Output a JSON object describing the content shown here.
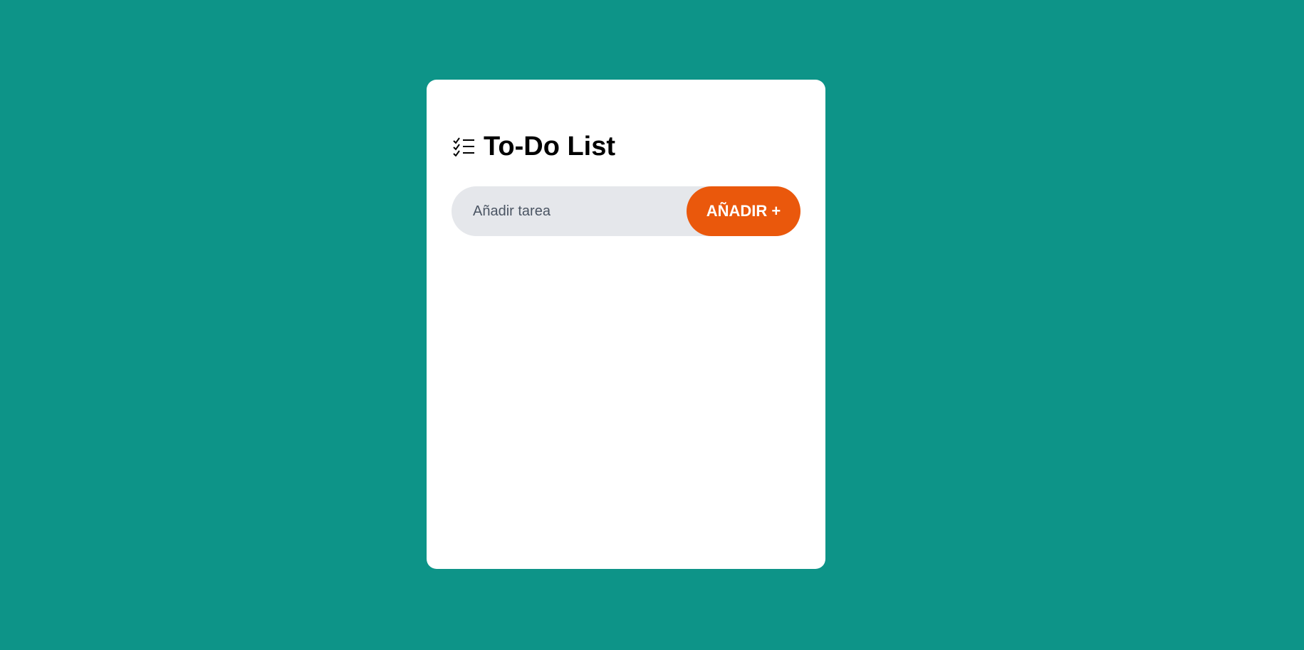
{
  "app": {
    "title": "To-Do List",
    "title_icon": "checklist-icon"
  },
  "form": {
    "input_value": "",
    "input_placeholder": "Añadir tarea",
    "add_button_label": "AÑADIR +"
  },
  "tasks": [],
  "colors": {
    "background": "#0d9488",
    "card": "#ffffff",
    "input_background": "#e5e7eb",
    "accent": "#ea580c"
  }
}
